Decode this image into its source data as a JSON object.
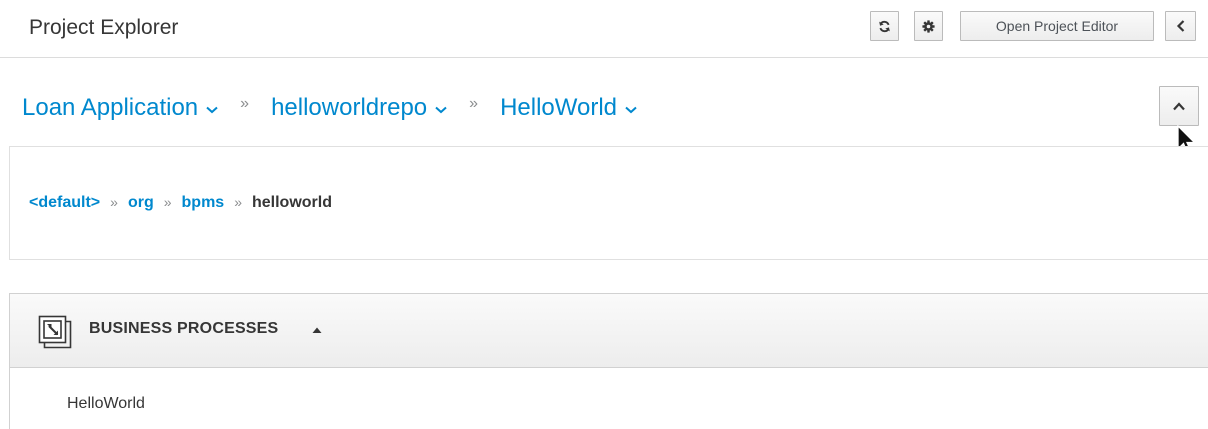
{
  "header": {
    "title": "Project Explorer",
    "refresh_icon": "refresh-icon",
    "settings_icon": "gear-icon",
    "open_editor_label": "Open Project Editor",
    "collapse_icon": "chevron-left-icon"
  },
  "project_breadcrumbs": {
    "items": [
      {
        "label": "Loan Application"
      },
      {
        "label": "helloworldrepo"
      },
      {
        "label": "HelloWorld"
      }
    ],
    "separator": "»",
    "collapse_icon": "chevron-up-icon"
  },
  "package_breadcrumbs": {
    "items": [
      "<default>",
      "org",
      "bpms"
    ],
    "current": "helloworld",
    "separator": "»"
  },
  "business_processes": {
    "title": "BUSINESS PROCESSES",
    "icon": "business-process-icon",
    "sort_icon": "caret-up-icon",
    "items": [
      "HelloWorld"
    ]
  },
  "colors": {
    "link": "#0088ce",
    "text": "#363636",
    "border": "#dcdcdc"
  }
}
